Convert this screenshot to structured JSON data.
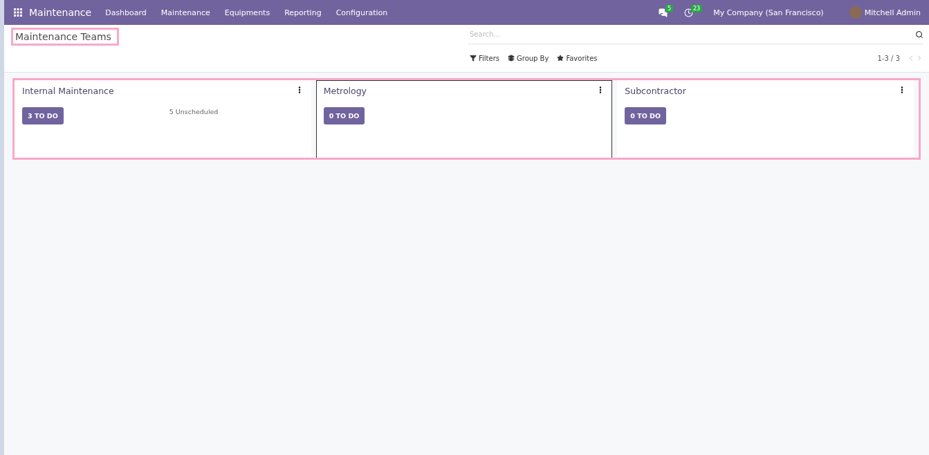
{
  "navbar": {
    "app_name": "Maintenance",
    "menu": [
      "Dashboard",
      "Maintenance",
      "Equipments",
      "Reporting",
      "Configuration"
    ],
    "messages_count": "5",
    "activities_count": "23",
    "company": "My Company (San Francisco)",
    "user": "Mitchell Admin"
  },
  "control_panel": {
    "title": "Maintenance Teams",
    "search": {
      "placeholder": "Search..."
    },
    "filters": [
      {
        "kind": "filter",
        "label": "Filters"
      },
      {
        "kind": "group",
        "label": "Group By"
      },
      {
        "kind": "favorite",
        "label": "Favorites"
      }
    ],
    "pager": "1-3 / 3"
  },
  "teams": [
    {
      "name": "Internal Maintenance",
      "todo": "3 TO DO",
      "unscheduled": "5 Unscheduled",
      "selected": false
    },
    {
      "name": "Metrology",
      "todo": "0 TO DO",
      "selected": true
    },
    {
      "name": "Subcontractor",
      "todo": "0 TO DO",
      "selected": false
    }
  ]
}
